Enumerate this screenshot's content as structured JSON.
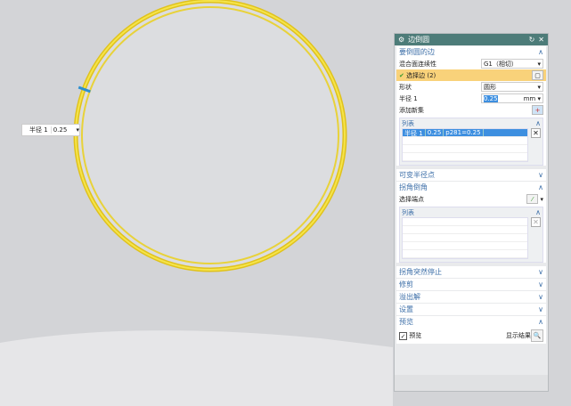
{
  "tooltip": {
    "label": "半径 1",
    "value": "0.25"
  },
  "dialog": {
    "title": "边倒圆",
    "edges_section": {
      "title": "要倒圆的边",
      "continuity_label": "混合面连续性",
      "continuity_value": "G1（相切）",
      "select_edge": "选择边 (2)",
      "shape_label": "形状",
      "shape_value": "圆形",
      "radius_label": "半径 1",
      "radius_value": "0.25",
      "radius_unit": "mm",
      "add_set": "添加新集",
      "list_title": "列表",
      "rows": [
        {
          "name": "半径 1",
          "value": "0.25",
          "expr": "p281=0.25"
        }
      ]
    },
    "variable_radius": "可变半径点",
    "corner": {
      "title": "拐角倒角",
      "select_end": "选择端点",
      "list_title": "列表"
    },
    "corner_stop": "拐角突然停止",
    "trim": "修剪",
    "overflow": "溢出解",
    "settings": "设置",
    "preview": {
      "title": "预览",
      "checkbox": "预览",
      "show_result": "显示结果"
    }
  }
}
